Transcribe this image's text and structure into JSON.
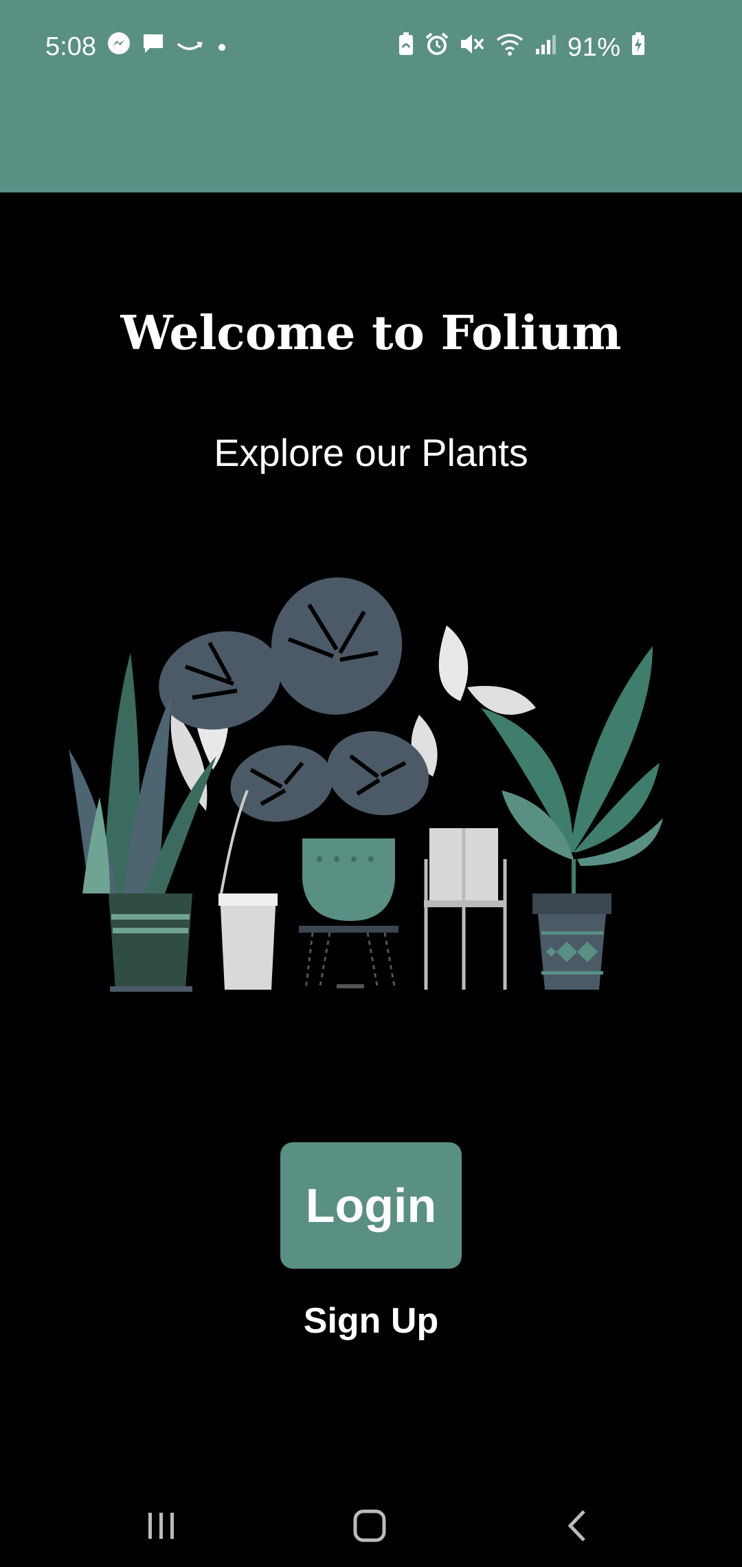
{
  "status_bar": {
    "time": "5:08",
    "battery": "91%",
    "left_icons": [
      "messenger-icon",
      "chat-bubble-icon",
      "amazon-icon",
      "dot-icon"
    ],
    "right_icons": [
      "battery-saver-icon",
      "alarm-icon",
      "mute-icon",
      "wifi-icon",
      "signal-icon",
      "battery-charging-icon"
    ]
  },
  "welcome": {
    "title": "Welcome to Folium",
    "subtitle": "Explore our Plants"
  },
  "actions": {
    "login_label": "Login",
    "signup_label": "Sign Up"
  },
  "nav": {
    "icons": [
      "recent-apps-icon",
      "home-icon",
      "back-icon"
    ]
  },
  "colors": {
    "accent": "#5a8f84",
    "background": "#000000",
    "text": "#ffffff"
  }
}
